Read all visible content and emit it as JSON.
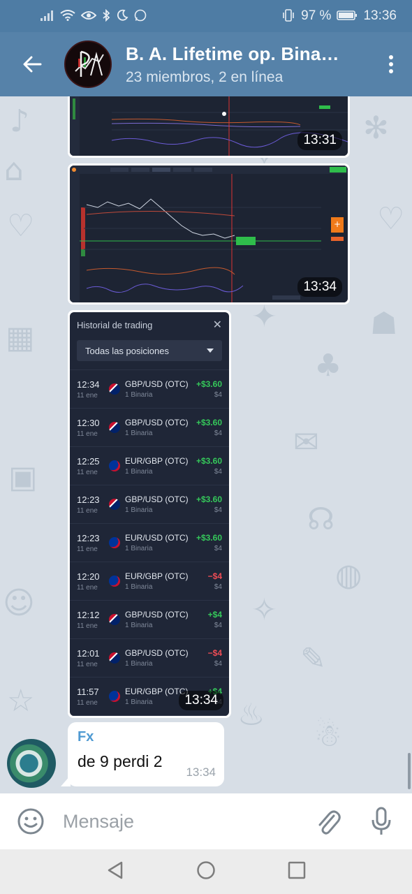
{
  "status_bar": {
    "battery": "97 %",
    "time": "13:36"
  },
  "header": {
    "title": "B. A. Lifetime op. Bina…",
    "subtitle": "23 miembros, 2 en línea"
  },
  "messages": {
    "image1": {
      "time": "13:31"
    },
    "image2": {
      "time": "13:34"
    },
    "trade_history": {
      "time": "13:34",
      "title": "Historial de trading",
      "filter": "Todas las posiciones",
      "rows": [
        {
          "time": "12:34",
          "date": "11 ene",
          "pair": "GBP/USD (OTC)",
          "type": "1 Binaria",
          "profit": "+$3.60",
          "stake": "$4",
          "flag": "gbp",
          "positive": true
        },
        {
          "time": "12:30",
          "date": "11 ene",
          "pair": "GBP/USD (OTC)",
          "type": "1 Binaria",
          "profit": "+$3.60",
          "stake": "$4",
          "flag": "gbp",
          "positive": true
        },
        {
          "time": "12:25",
          "date": "11 ene",
          "pair": "EUR/GBP (OTC)",
          "type": "1 Binaria",
          "profit": "+$3.60",
          "stake": "$4",
          "flag": "eur",
          "positive": true
        },
        {
          "time": "12:23",
          "date": "11 ene",
          "pair": "GBP/USD (OTC)",
          "type": "1 Binaria",
          "profit": "+$3.60",
          "stake": "$4",
          "flag": "gbp",
          "positive": true
        },
        {
          "time": "12:23",
          "date": "11 ene",
          "pair": "EUR/USD (OTC)",
          "type": "1 Binaria",
          "profit": "+$3.60",
          "stake": "$4",
          "flag": "eur",
          "positive": true
        },
        {
          "time": "12:20",
          "date": "11 ene",
          "pair": "EUR/GBP (OTC)",
          "type": "1 Binaria",
          "profit": "−$4",
          "stake": "$4",
          "flag": "eur",
          "positive": false
        },
        {
          "time": "12:12",
          "date": "11 ene",
          "pair": "GBP/USD (OTC)",
          "type": "1 Binaria",
          "profit": "+$4",
          "stake": "$4",
          "flag": "gbp",
          "positive": true
        },
        {
          "time": "12:01",
          "date": "11 ene",
          "pair": "GBP/USD (OTC)",
          "type": "1 Binaria",
          "profit": "−$4",
          "stake": "$4",
          "flag": "gbp",
          "positive": false
        },
        {
          "time": "11:57",
          "date": "11 ene",
          "pair": "EUR/GBP (OTC)",
          "type": "1 Binaria",
          "profit": "+$4",
          "stake": "$4",
          "flag": "eur",
          "positive": true
        }
      ]
    },
    "text_message": {
      "sender": "Fx",
      "text": "de 9 perdi 2",
      "time": "13:34"
    }
  },
  "composer": {
    "placeholder": "Mensaje"
  },
  "colors": {
    "header_bg": "#5682a9",
    "status_bg": "#4e7ca4",
    "profit_positive": "#35c85a",
    "profit_negative": "#ee4c55",
    "sender_name": "#4f9ad2"
  }
}
